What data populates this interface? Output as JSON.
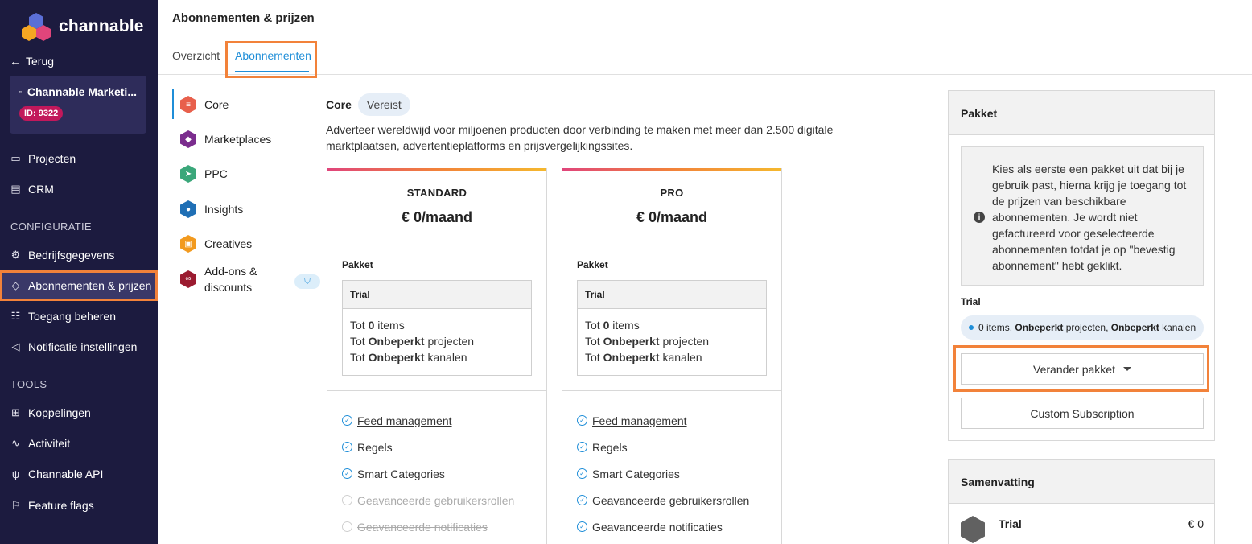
{
  "brand": {
    "name": "channable"
  },
  "sidebar": {
    "back_label": "Terug",
    "org_name": "Channable Marketi...",
    "org_id": "ID: 9322",
    "items_top": [
      {
        "label": "Projecten",
        "icon": "folder-icon"
      },
      {
        "label": "CRM",
        "icon": "book-icon"
      }
    ],
    "section_config": "CONFIGURATIE",
    "items_config": [
      {
        "label": "Bedrijfsgegevens",
        "icon": "gear-icon"
      },
      {
        "label": "Abonnementen & prijzen",
        "icon": "tag-icon",
        "active": true
      },
      {
        "label": "Toegang beheren",
        "icon": "users-icon"
      },
      {
        "label": "Notificatie instellingen",
        "icon": "megaphone-icon"
      }
    ],
    "section_tools": "TOOLS",
    "items_tools": [
      {
        "label": "Koppelingen",
        "icon": "sitemap-icon"
      },
      {
        "label": "Activiteit",
        "icon": "pulse-icon"
      },
      {
        "label": "Channable API",
        "icon": "plug-icon"
      },
      {
        "label": "Feature flags",
        "icon": "flag-icon"
      }
    ]
  },
  "header": {
    "title": "Abonnementen & prijzen",
    "tabs": [
      {
        "label": "Overzicht"
      },
      {
        "label": "Abonnementen",
        "active": true
      }
    ]
  },
  "categories": [
    {
      "label": "Core",
      "color": "#e8604c"
    },
    {
      "label": "Marketplaces",
      "color": "#7b2d8e"
    },
    {
      "label": "PPC",
      "color": "#3aa77a"
    },
    {
      "label": "Insights",
      "color": "#1f6fb5"
    },
    {
      "label": "Creatives",
      "color": "#f29a1f"
    },
    {
      "label": "Add-ons & discounts",
      "color": "#9b1b30"
    }
  ],
  "core": {
    "title": "Core",
    "badge": "Vereist",
    "description": "Adverteer wereldwijd voor miljoenen producten door verbinding te maken met meer dan 2.500 digitale marktplaatsen, advertentieplatforms en prijsvergelijkingssites."
  },
  "plans": [
    {
      "name": "STANDARD",
      "price": "€ 0/maand",
      "pakket_label": "Pakket",
      "box_title": "Trial",
      "lines": [
        {
          "pre": "Tot ",
          "bold": "0",
          "post": " items"
        },
        {
          "pre": "Tot ",
          "bold": "Onbeperkt",
          "post": " projecten"
        },
        {
          "pre": "Tot ",
          "bold": "Onbeperkt",
          "post": " kanalen"
        }
      ],
      "features": [
        {
          "label": "Feed management",
          "enabled": true,
          "link": true
        },
        {
          "label": "Regels",
          "enabled": true
        },
        {
          "label": "Smart Categories",
          "enabled": true
        },
        {
          "label": "Geavanceerde gebruikersrollen",
          "enabled": false
        },
        {
          "label": "Geavanceerde notificaties",
          "enabled": false
        }
      ]
    },
    {
      "name": "PRO",
      "price": "€ 0/maand",
      "pakket_label": "Pakket",
      "box_title": "Trial",
      "lines": [
        {
          "pre": "Tot ",
          "bold": "0",
          "post": " items"
        },
        {
          "pre": "Tot ",
          "bold": "Onbeperkt",
          "post": " projecten"
        },
        {
          "pre": "Tot ",
          "bold": "Onbeperkt",
          "post": " kanalen"
        }
      ],
      "features": [
        {
          "label": "Feed management",
          "enabled": true,
          "link": true
        },
        {
          "label": "Regels",
          "enabled": true
        },
        {
          "label": "Smart Categories",
          "enabled": true
        },
        {
          "label": "Geavanceerde gebruikersrollen",
          "enabled": true
        },
        {
          "label": "Geavanceerde notificaties",
          "enabled": true
        }
      ]
    }
  ],
  "package_card": {
    "title": "Pakket",
    "info": "Kies als eerste een pakket uit dat bij je gebruik past, hierna krijg je toegang tot de prijzen van beschikbare abonnementen. Je wordt niet gefactureerd voor geselecteerde abonnementen totdat je op \"bevestig abonnement\" hebt geklikt.",
    "trial_label": "Trial",
    "trial_summary": {
      "items": "0",
      "items_suffix": " items, ",
      "projects": "Onbeperkt",
      "projects_suffix": " projecten, ",
      "channels": "Onbeperkt",
      "channels_suffix": " kanalen"
    },
    "change_button": "Verander pakket",
    "custom_button": "Custom Subscription"
  },
  "summary_card": {
    "title": "Samenvatting",
    "row_name": "Trial",
    "row_price": "€ 0"
  },
  "colors": {
    "accent": "#1f8ed8",
    "highlight": "#f2823a",
    "sidebar": "#1c1b3f"
  }
}
